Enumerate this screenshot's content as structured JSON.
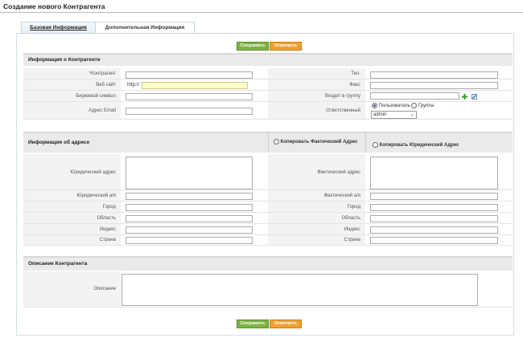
{
  "page": {
    "title": "Создание нового Контрагента"
  },
  "tabs": [
    {
      "label": "Базовая Информация"
    },
    {
      "label": "Дополнительная Информация"
    }
  ],
  "buttons": {
    "save": "Сохранить",
    "cancel": "Отменить"
  },
  "sections": {
    "contractor": "Информация о Контрагенте",
    "address": "Информация об адресе",
    "description": "Описание Контрагента"
  },
  "contractor_fields": {
    "name_label": "*Контрагент",
    "website_label": "Веб сайт",
    "website_prefix": "http://",
    "ticker_label": "Биржевой символ",
    "email_label": "Адрес Email",
    "phone_label": "Тел.",
    "fax_label": "Факс",
    "group_label": "Входит в группу",
    "owner_label": "Ответственный",
    "owner_user_option": "Пользователь",
    "owner_group_option": "Группа",
    "owner_selected": "admin"
  },
  "address": {
    "copy_actual": "Копировать Фактический Адрес",
    "copy_legal": "Копировать Юридический Адрес",
    "left_labels": [
      "Юридический адрес",
      "Юридический а/я",
      "Город",
      "Область",
      "Индекс",
      "Страна"
    ],
    "right_labels": [
      "Фактический адрес",
      "Фактический а/я",
      "Город",
      "Город",
      "Область",
      "Индекс",
      "Страна"
    ]
  },
  "description": {
    "label": "Описание"
  }
}
